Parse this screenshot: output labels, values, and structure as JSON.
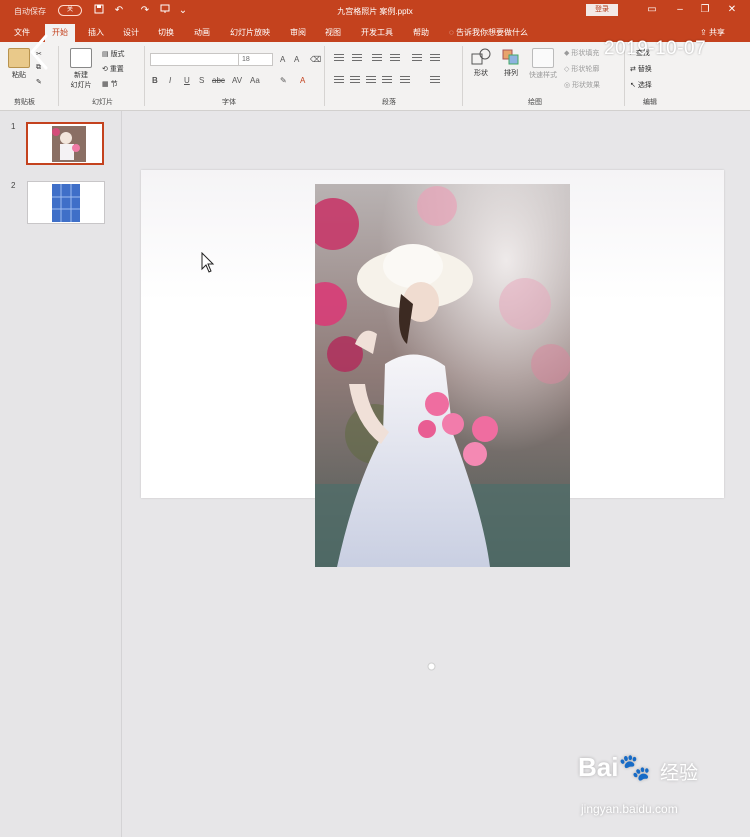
{
  "titlebar": {
    "autosave_label": "自动保存",
    "autosave_state": "关",
    "title": "九宫格照片 案例.pptx",
    "login_label": "登录",
    "quick_access": [
      "save-icon",
      "undo-icon",
      "redo-icon",
      "present-icon"
    ]
  },
  "tabs": [
    "文件",
    "开始",
    "插入",
    "设计",
    "切换",
    "动画",
    "幻灯片放映",
    "审阅",
    "视图",
    "开发工具",
    "帮助"
  ],
  "active_tab": "开始",
  "tell_me": "告诉我你想要做什么",
  "share_label": "共享",
  "ribbon": {
    "clipboard": {
      "paste": "粘贴",
      "label": "剪贴板"
    },
    "slides": {
      "new_slide": "新建",
      "new_slide_2": "幻灯片",
      "layout": "版式",
      "reset": "重置",
      "section": "节",
      "label": "幻灯片"
    },
    "font": {
      "font_name": "",
      "font_size": "18",
      "bold": "B",
      "italic": "I",
      "underline": "U",
      "strike": "S",
      "shadow": "abc",
      "spacing": "AV",
      "case": "Aa",
      "label": "字体"
    },
    "paragraph": {
      "label": "段落"
    },
    "drawing": {
      "shapes": "形状",
      "arrange": "排列",
      "quick_styles": "快速样式",
      "fill": "形状填充",
      "outline": "形状轮廓",
      "effects": "形状效果",
      "label": "绘图"
    },
    "editing": {
      "find": "查找",
      "replace": "替换",
      "select": "选择",
      "label": "编辑"
    }
  },
  "thumbnails": [
    {
      "number": "1",
      "selected": true
    },
    {
      "number": "2",
      "selected": false
    }
  ],
  "overlay": {
    "date": "2019-10-07"
  },
  "watermark": {
    "brand": "Bai",
    "brand_cn": "经验",
    "url": "jingyan.baidu.com"
  },
  "colors": {
    "accent": "#c4421e",
    "ribbon_bg": "#f3f2f1",
    "workspace_bg": "#e7e6e8"
  }
}
